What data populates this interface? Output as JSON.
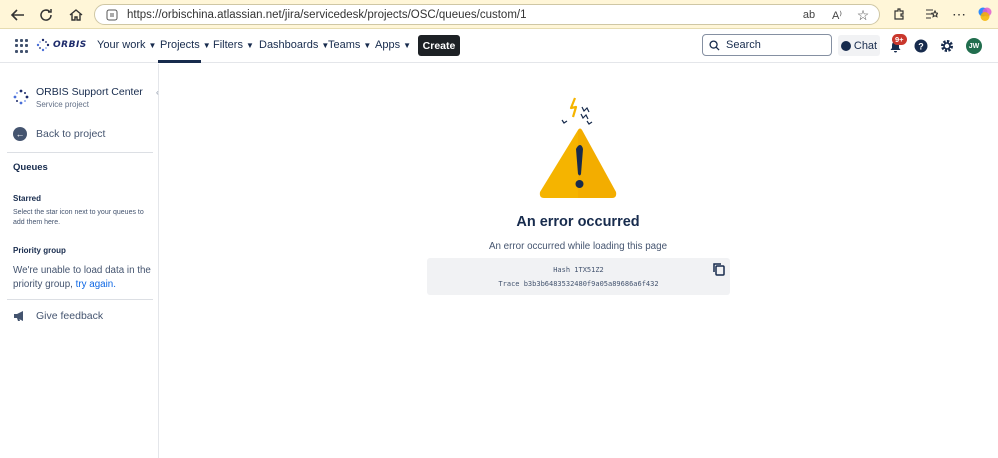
{
  "browser": {
    "url": "https://orbischina.atlassian.net/jira/servicedesk/projects/OSC/queues/custom/1"
  },
  "header": {
    "logo_text": "ORBIS",
    "nav": [
      {
        "label": "Your work"
      },
      {
        "label": "Projects"
      },
      {
        "label": "Filters"
      },
      {
        "label": "Dashboards"
      },
      {
        "label": "Teams"
      },
      {
        "label": "Apps"
      }
    ],
    "create_label": "Create",
    "search_placeholder": "Search",
    "chat_label": "Chat",
    "notifications_badge": "9+",
    "avatar_initials": "JW"
  },
  "sidebar": {
    "project_name": "ORBIS Support Center",
    "project_type": "Service project",
    "back_label": "Back to project",
    "queues_heading": "Queues",
    "starred_heading": "Starred",
    "starred_text": "Select the star icon next to your queues to add them here.",
    "priority_heading": "Priority group",
    "priority_text": "We're unable to load data in the priority group,",
    "priority_link": "try again.",
    "feedback_label": "Give feedback"
  },
  "main": {
    "error_title": "An error occurred",
    "error_subtitle": "An error occurred while loading this page",
    "hash_line": "Hash 1TX51Z2",
    "trace_line": "Trace b3b3b6483532480f9a05a89686a6f432"
  },
  "colors": {
    "browser_bar": "#fff6d8",
    "create_button": "#1d2125",
    "link": "#0c66e4",
    "badge": "#c9372c",
    "avatar": "#216e4e",
    "warning": "#f5b400"
  }
}
